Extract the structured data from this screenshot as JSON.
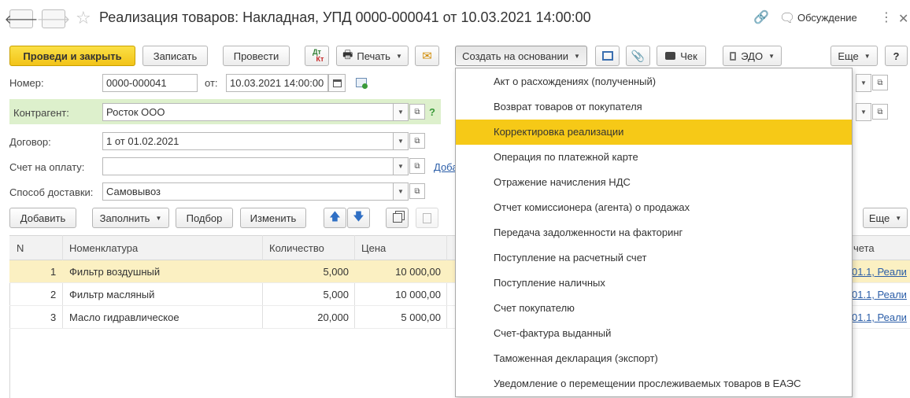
{
  "window": {
    "title": "Реализация товаров: Накладная, УПД 0000-000041 от 10.03.2021 14:00:00",
    "discuss_label": "Обсуждение",
    "back_glyph": "🡐",
    "forward_glyph": "🡒",
    "star_glyph": "☆",
    "link_glyph": "🔗",
    "discuss_glyph": "🗨",
    "more_glyph": "⋮",
    "close_glyph": "✕"
  },
  "toolbar": {
    "post_close": "Проведи и закрыть",
    "save": "Записать",
    "post": "Провести",
    "dtkt_top": "Дт",
    "dtkt_bottom": "Кт",
    "print": "Печать",
    "create_based": "Создать на основании",
    "check": "Чек",
    "edo": "ЭДО",
    "more": "Еще",
    "help": "?",
    "print_glyph": "🖶",
    "mail_glyph": "✉",
    "clip_glyph": "📎",
    "caret": "▼"
  },
  "form": {
    "number_label": "Номер:",
    "number_value": "0000-000041",
    "date_label": "от:",
    "date_value": "10.03.2021 14:00:00",
    "contractor_label": "Контрагент:",
    "contractor_value": "Росток ООО",
    "contract_label": "Договор:",
    "contract_value": "1 от 01.02.2021",
    "invoice_label": "Счет на оплату:",
    "invoice_value": "",
    "invoice_link_partial": "Доба",
    "delivery_label": "Способ доставки:",
    "delivery_value": "Самовывоз",
    "question": "?"
  },
  "table_toolbar": {
    "add": "Добавить",
    "fill": "Заполнить",
    "pick": "Подбор",
    "change": "Изменить",
    "more": "Еще",
    "up_glyph": "🡅",
    "down_glyph": "🡇"
  },
  "table": {
    "headers": [
      "N",
      "Номенклатура",
      "Количество",
      "Цена"
    ],
    "header_partial_right": "чета",
    "rows": [
      {
        "n": "1",
        "name": "Фильтр воздушный",
        "qty": "5,000",
        "price": "10 000,00",
        "account": "01.1, Реали"
      },
      {
        "n": "2",
        "name": "Фильтр масляный",
        "qty": "5,000",
        "price": "10 000,00",
        "account": "01.1, Реали"
      },
      {
        "n": "3",
        "name": "Масло гидравлическое",
        "qty": "20,000",
        "price": "5 000,00",
        "account": "01.1, Реали"
      }
    ]
  },
  "menu": {
    "items": [
      "Акт о расхождениях (полученный)",
      "Возврат товаров от покупателя",
      "Корректировка реализации",
      "Операция по платежной карте",
      "Отражение начисления НДС",
      "Отчет комиссионера (агента) о продажах",
      "Передача задолженности на факторинг",
      "Поступление на расчетный счет",
      "Поступление наличных",
      "Счет покупателю",
      "Счет-фактура выданный",
      "Таможенная декларация (экспорт)",
      "Уведомление о перемещении прослеживаемых товаров в ЕАЭС"
    ],
    "highlighted_index": 2
  },
  "colors": {
    "primary_button": "#f6c917",
    "menu_highlight": "#f6c917",
    "selected_row": "#fbf0c2",
    "contractor_row": "#ddf0cc",
    "link": "#2b5ea8",
    "help_green": "#3a9a3a"
  }
}
